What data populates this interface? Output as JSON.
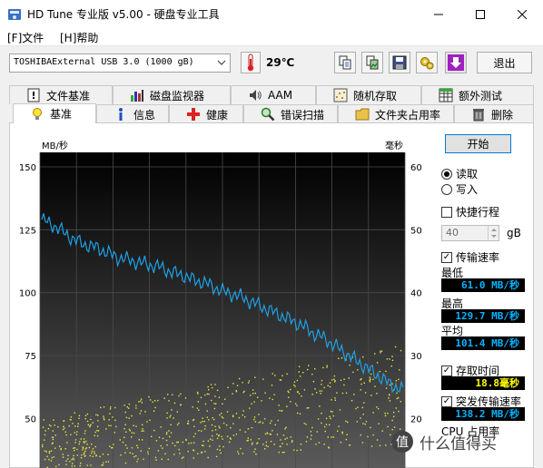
{
  "window": {
    "title": "HD Tune 专业版 v5.00 - 硬盘专业工具"
  },
  "menu": [
    {
      "label": "[F]文件"
    },
    {
      "label": "[H]帮助"
    }
  ],
  "toolbar": {
    "drive": "TOSHIBAExternal USB 3.0 (1000 gB)",
    "temperature": "29℃",
    "exit_label": "退出"
  },
  "tabs_top": [
    {
      "label": "文件基准",
      "icon": "info-exclaim-icon"
    },
    {
      "label": "磁盘监视器",
      "icon": "bar-chart-icon"
    },
    {
      "label": "AAM",
      "icon": "speaker-icon"
    },
    {
      "label": "随机存取",
      "icon": "scatter-icon"
    },
    {
      "label": "额外测试",
      "icon": "grid-icon"
    }
  ],
  "tabs_bottom": [
    {
      "label": "基准",
      "icon": "bulb-icon",
      "active": true
    },
    {
      "label": "信息",
      "icon": "info-icon"
    },
    {
      "label": "健康",
      "icon": "plus-cross-icon"
    },
    {
      "label": "错误扫描",
      "icon": "magnifier-icon"
    },
    {
      "label": "文件夹占用率",
      "icon": "folder-icon"
    },
    {
      "label": "删除",
      "icon": "trash-icon"
    }
  ],
  "controls": {
    "start_label": "开始",
    "read_label": "读取",
    "write_label": "写入",
    "mode": "read",
    "short_stroke_label": "快捷行程",
    "short_stroke_checked": false,
    "short_stroke_value": "40",
    "short_stroke_unit": "gB",
    "transfer_rate_label": "传输速率",
    "transfer_rate_checked": true,
    "access_time_label": "存取时间",
    "access_time_checked": true,
    "burst_label": "突发传输速率",
    "burst_checked": true,
    "cpu_label": "CPU 占用率"
  },
  "results": {
    "min_label": "最低",
    "min_value": "61.0 MB/秒",
    "max_label": "最高",
    "max_value": "129.7 MB/秒",
    "avg_label": "平均",
    "avg_value": "101.4 MB/秒",
    "access_value": "18.8毫秒",
    "burst_value": "138.2 MB/秒"
  },
  "watermark": "什么值得买",
  "chart_data": {
    "type": "line",
    "ylabel": "MB/秒",
    "y2label": "毫秒",
    "ylim": [
      0,
      150
    ],
    "y2lim": [
      0,
      60
    ],
    "yticks": [
      "150",
      "125",
      "100",
      "75",
      "50",
      "25"
    ],
    "y2ticks": [
      "60",
      "50",
      "40",
      "30",
      "20",
      "10"
    ],
    "grid": true,
    "colors": {
      "transfer": "#1ea0e6",
      "access": "#e8e83a",
      "bg_top": "#000000",
      "bg_bottom": "#5a5a5a"
    },
    "series": [
      {
        "x": [
          0,
          3,
          6,
          9,
          12,
          15,
          18,
          21,
          24,
          27,
          30,
          33,
          36,
          39,
          42,
          45,
          48,
          51,
          54,
          57,
          60,
          63,
          66,
          69,
          72,
          75,
          78,
          81,
          84,
          87,
          90,
          93,
          96,
          100
        ],
        "values": [
          129,
          127,
          124,
          121,
          119,
          118,
          116,
          114,
          113,
          112,
          111,
          110,
          108,
          107,
          105,
          104,
          102,
          100,
          99,
          97,
          95,
          93,
          91,
          89,
          87,
          84,
          82,
          79,
          76,
          73,
          70,
          67,
          64,
          61
        ]
      }
    ],
    "access_band": {
      "min_ms": 12,
      "max_ms": 30
    }
  }
}
